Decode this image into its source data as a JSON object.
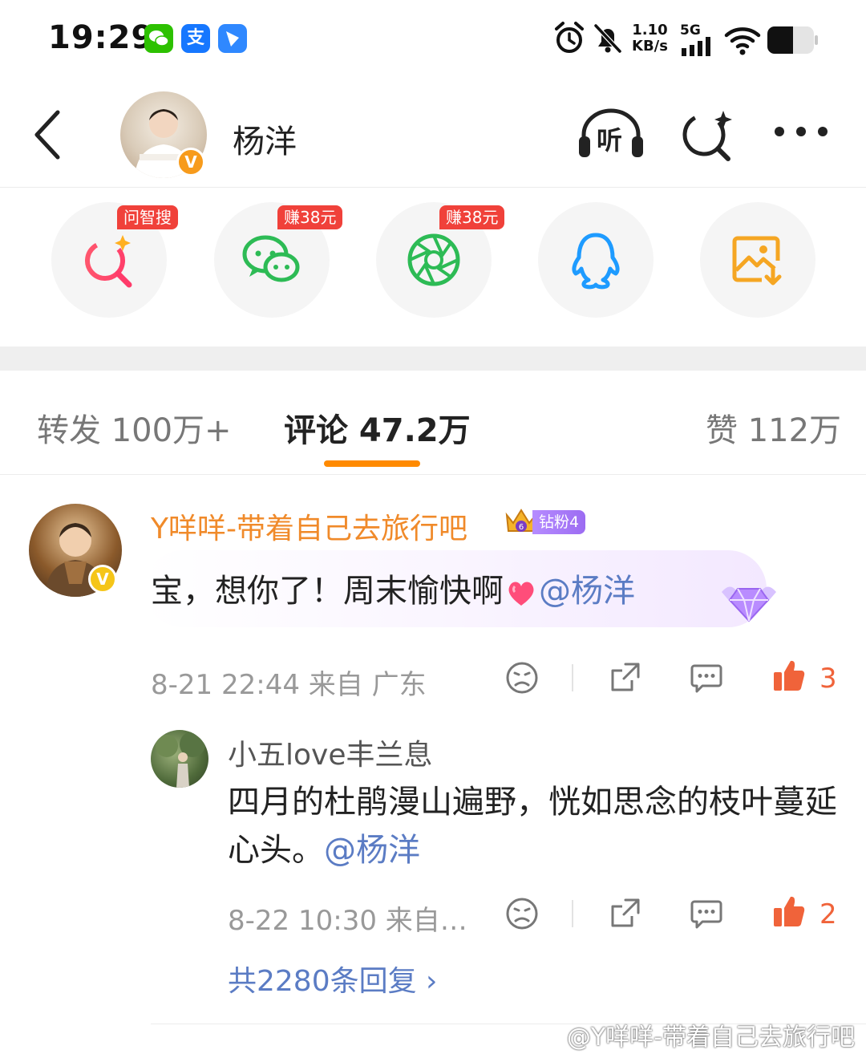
{
  "status_bar": {
    "time": "19:29",
    "apps": [
      {
        "icon": "wechat-icon",
        "color": "#2dc100"
      },
      {
        "icon": "alipay-icon",
        "color": "#1677ff",
        "glyph": "支"
      },
      {
        "icon": "feishu-icon",
        "color": "#2f88ff"
      }
    ],
    "net_speed_value": "1.10",
    "net_speed_unit": "KB/s",
    "network": "5G"
  },
  "header": {
    "title": "杨洋",
    "listen_label": "听"
  },
  "share_options": [
    {
      "icon": "ai-search-icon",
      "tag": "问智搜"
    },
    {
      "icon": "wechat-icon",
      "tag": "赚38元"
    },
    {
      "icon": "moments-icon",
      "tag": "赚38元"
    },
    {
      "icon": "qq-icon",
      "tag": ""
    },
    {
      "icon": "save-image-icon",
      "tag": ""
    }
  ],
  "tabs": {
    "repost": "转发 100万+",
    "comments": "评论 47.2万",
    "likes": "赞 112万"
  },
  "comment": {
    "author": "Y咩咩-带着自己去旅行吧",
    "fan_badge": "钻粉4",
    "crown_level": "6",
    "text": "宝，想你了！周末愉快啊",
    "mention": "@杨洋",
    "time": "8-21 22:44",
    "location": "来自 广东",
    "likes": "3"
  },
  "reply": {
    "author": "小五love丰兰息",
    "text": "四月的杜鹃漫山遍野，恍如思念的枝叶蔓延心头。",
    "mention": "@杨洋",
    "time": "8-22 10:30",
    "location": "来自…",
    "likes": "2"
  },
  "more_replies": "共2280条回复 ›",
  "watermark": "@Y咩咩-带着自己去旅行吧",
  "colors": {
    "accent": "#ff8a00",
    "username": "#f08a2a",
    "mention": "#5b7cc4",
    "like": "#f0633a",
    "tag": "#f0413a"
  }
}
